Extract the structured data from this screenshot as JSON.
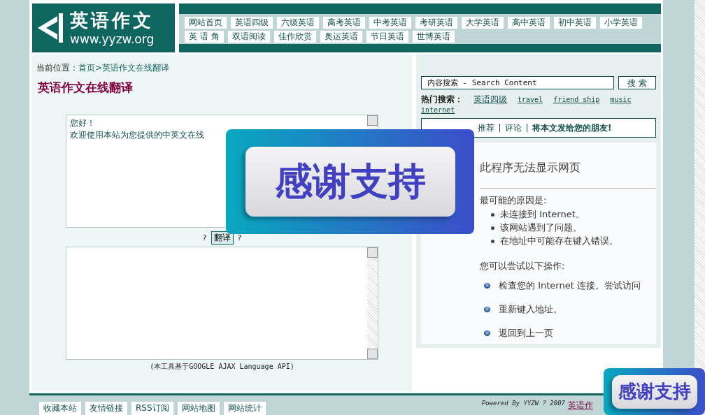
{
  "logo": {
    "title": "英语作文",
    "url": "www.yyzw.org"
  },
  "nav": [
    [
      "网站首页",
      "英语四级",
      "六级英语",
      "高考英语",
      "中考英语",
      "考研英语",
      "大学英语",
      "高中英语",
      "初中英语",
      "小学英语"
    ],
    [
      "英 语 角",
      "双语阅读",
      "佳作欣赏",
      "奥运英语",
      "节日英语",
      "世博英语"
    ]
  ],
  "breadcrumb": {
    "label": "当前位置：",
    "links": [
      "首页",
      ">英语作文在线翻译"
    ]
  },
  "page_title": "英语作文在线翻译",
  "source_box": {
    "lines": [
      "您好！",
      "欢迎使用本站为您提供的中英文在线"
    ]
  },
  "translate": {
    "before": "?",
    "button": "翻译",
    "after": "?"
  },
  "caption": "(本工具基于GOOGLE AJAX Language API)",
  "search": {
    "placeholder": "内容搜索 - Search Content",
    "button": "搜 索"
  },
  "hot_search": {
    "label": "热门搜索：",
    "links": [
      "英语四级",
      "travel",
      "friend ship",
      "music",
      "internet"
    ]
  },
  "actions": [
    {
      "label": "推荐",
      "bold": false
    },
    {
      "label": "评论",
      "bold": false
    },
    {
      "label": "将本文发给您的朋友!",
      "bold": true
    }
  ],
  "error_page": {
    "title": "此程序无法显示网页",
    "causes_heading": "最可能的原因是:",
    "causes": [
      "未连接到 Internet。",
      "该网站遇到了问题。",
      "在地址中可能存在键入错误。"
    ],
    "tries_heading": "您可以尝试以下操作:",
    "tries": [
      "检查您的 Internet 连接。尝试访问",
      "重新键入地址。",
      "返回到上一页"
    ]
  },
  "footer": {
    "links": [
      "收藏本站",
      "友情链接",
      "RSS订阅",
      "网站地图",
      "网站统计"
    ],
    "powered": "Powered By YYZW ? 2007",
    "site_link": "英语作"
  },
  "overlays": [
    {
      "kind": "large",
      "text": "感谢支持"
    },
    {
      "kind": "small",
      "text": "感谢支持"
    }
  ]
}
